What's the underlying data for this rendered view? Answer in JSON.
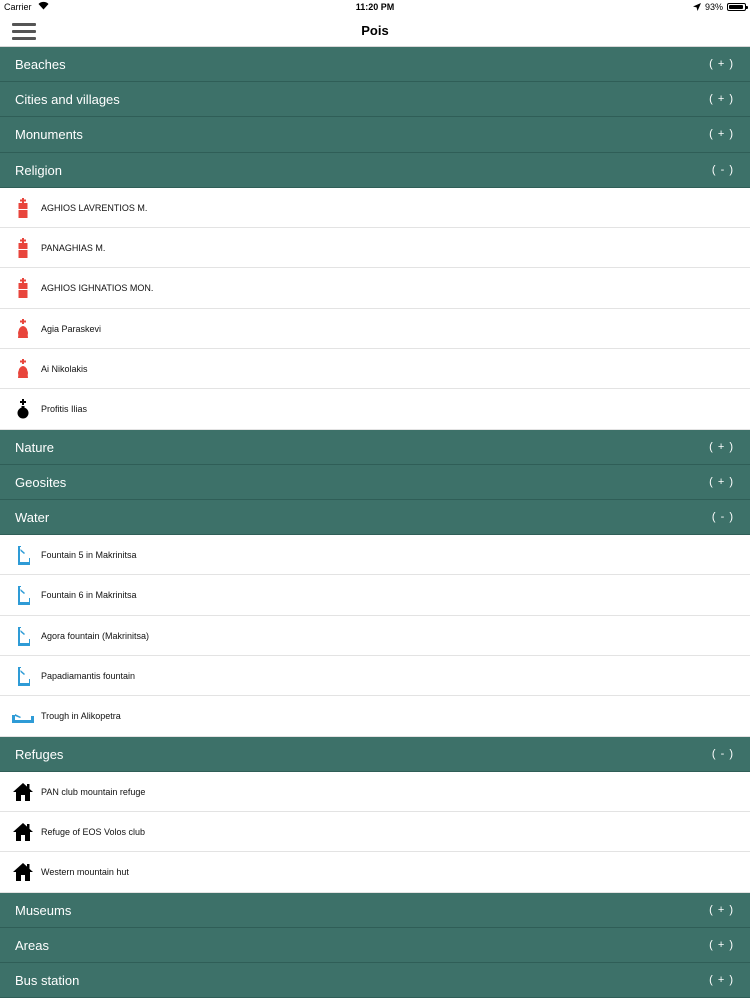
{
  "status": {
    "carrier": "Carrier",
    "time": "11:20 PM",
    "battery": "93%",
    "battery_level": 0.93
  },
  "nav": {
    "title": "Pois",
    "menu_icon": "hamburger-menu-icon"
  },
  "colors": {
    "category_bg": "#3d7169",
    "religion_red": "#e8453c",
    "water_blue": "#2e9bd6",
    "refuge_black": "#000000"
  },
  "categories": [
    {
      "label": "Beaches",
      "toggle": "( + )"
    },
    {
      "label": "Cities and villages",
      "toggle": "( + )"
    },
    {
      "label": "Monuments",
      "toggle": "( + )"
    },
    {
      "label": "Religion",
      "toggle": "( - )",
      "items": [
        {
          "label": "AGHIOS LAVRENTIOS M.",
          "icon": "red-monastery-icon"
        },
        {
          "label": "PANAGHIAS M.",
          "icon": "red-monastery-icon"
        },
        {
          "label": "AGHIOS IGHNATIOS MON.",
          "icon": "red-monastery-icon"
        },
        {
          "label": "Agia Paraskevi",
          "icon": "red-church-icon"
        },
        {
          "label": "Ai Nikolakis",
          "icon": "red-church-icon"
        },
        {
          "label": "Profitis Ilias",
          "icon": "black-church-icon"
        }
      ]
    },
    {
      "label": "Nature",
      "toggle": "( + )"
    },
    {
      "label": "Geosites",
      "toggle": "( + )"
    },
    {
      "label": "Water",
      "toggle": "( - )",
      "items": [
        {
          "label": "Fountain 5 in Makrinitsa",
          "icon": "fountain-icon"
        },
        {
          "label": "Fountain 6 in Makrinitsa",
          "icon": "fountain-icon"
        },
        {
          "label": "Agora fountain (Makrinitsa)",
          "icon": "fountain-icon"
        },
        {
          "label": "Papadiamantis fountain",
          "icon": "fountain-icon"
        },
        {
          "label": "Trough in Alikopetra",
          "icon": "trough-icon"
        }
      ]
    },
    {
      "label": "Refuges",
      "toggle": "( - )",
      "items": [
        {
          "label": "PAN club mountain refuge",
          "icon": "house-icon"
        },
        {
          "label": "Refuge of EOS Volos club",
          "icon": "house-icon"
        },
        {
          "label": "Western mountain hut",
          "icon": "house-icon"
        }
      ]
    },
    {
      "label": "Museums",
      "toggle": "( + )"
    },
    {
      "label": "Areas",
      "toggle": "( + )"
    },
    {
      "label": "Bus station",
      "toggle": "( + )"
    }
  ]
}
